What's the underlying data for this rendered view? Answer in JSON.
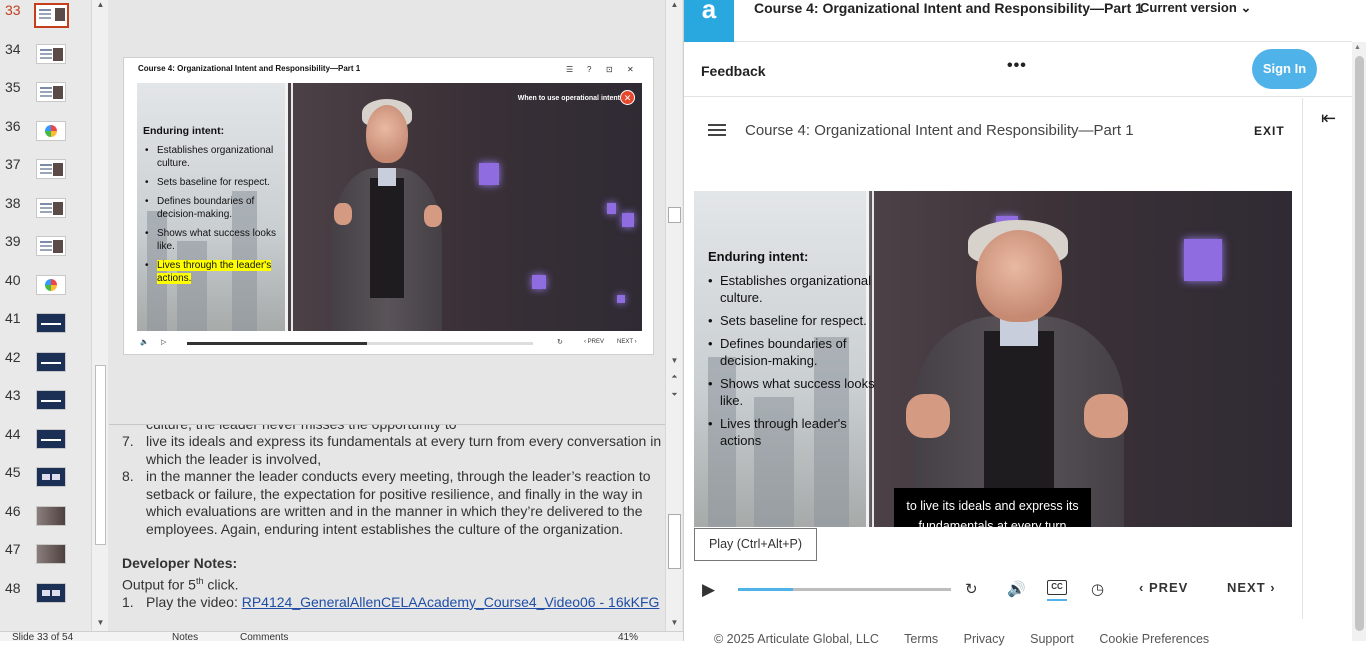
{
  "ppt": {
    "thumbnails": [
      {
        "num": "33",
        "kind": "sel"
      },
      {
        "num": "34",
        "kind": "text"
      },
      {
        "num": "35",
        "kind": "text"
      },
      {
        "num": "36",
        "kind": "pie"
      },
      {
        "num": "37",
        "kind": "text"
      },
      {
        "num": "38",
        "kind": "text"
      },
      {
        "num": "39",
        "kind": "text"
      },
      {
        "num": "40",
        "kind": "pie"
      },
      {
        "num": "41",
        "kind": "dark"
      },
      {
        "num": "42",
        "kind": "dark"
      },
      {
        "num": "43",
        "kind": "dark"
      },
      {
        "num": "44",
        "kind": "dark"
      },
      {
        "num": "45",
        "kind": "blue2"
      },
      {
        "num": "46",
        "kind": "photo"
      },
      {
        "num": "47",
        "kind": "photo"
      },
      {
        "num": "48",
        "kind": "blue2"
      }
    ],
    "slide": {
      "title": "Course 4: Organizational Intent and Responsibility—Part 1",
      "chip": "When to use operational intent",
      "heading": "Enduring intent:",
      "bullets": [
        "Establishes organizational culture.",
        "Sets baseline for respect.",
        "Defines boundaries of decision-making.",
        "Shows what success looks like.",
        "Lives through the leader's actions."
      ],
      "prev": "PREV",
      "next": "NEXT",
      "progress": 0.52
    },
    "notes": {
      "partial_line": "culture, the leader never misses the opportunity to",
      "items": [
        {
          "n": "7.",
          "text": "live its ideals and express its fundamentals at every turn from every conversation in which the leader is involved,"
        },
        {
          "n": "8.",
          "text": "in the manner the leader conducts every meeting, through the leader’s reaction to setback or failure, the expectation for positive resilience, and finally in the way in which evaluations are written and in the manner in which they’re delivered to the employees. Again, enduring intent establishes the culture of the organization."
        }
      ],
      "dev_heading": "Developer Notes:",
      "output_prefix": "Output for 5",
      "output_sup": "th",
      "output_suffix": " click.",
      "play_n": "1.",
      "play_label": "Play the video: ",
      "play_link": "RP4124_GeneralAllenCELAAcademy_Course4_Video06 - 16kKFG"
    },
    "status": {
      "slide_of": "Slide 33 of 54",
      "notes": "Notes",
      "comments": "Comments",
      "zoom": "41%"
    }
  },
  "web": {
    "logo": "a",
    "top_title": "Course 4: Organizational Intent and Responsibility—Part 1",
    "version": "Current version",
    "feedback": "Feedback",
    "more": "•••",
    "sign_in": "Sign In",
    "player": {
      "title": "Course 4: Organizational Intent and Responsibility—Part 1",
      "exit": "EXIT",
      "heading": "Enduring intent:",
      "bullets": [
        "Establishes organizational culture.",
        "Sets baseline for respect.",
        "Defines boundaries of decision-making.",
        "Shows what success looks like.",
        "Lives through leader's actions"
      ],
      "caption": "to live its ideals and express its fundamentals at every turn",
      "play_tip": "Play (Ctrl+Alt+P)",
      "prev": "PREV",
      "next": "NEXT",
      "cc": "CC",
      "progress": 0.26
    },
    "footer": [
      "© 2025 Articulate Global, LLC",
      "Terms",
      "Privacy",
      "Support",
      "Cookie Preferences"
    ]
  }
}
